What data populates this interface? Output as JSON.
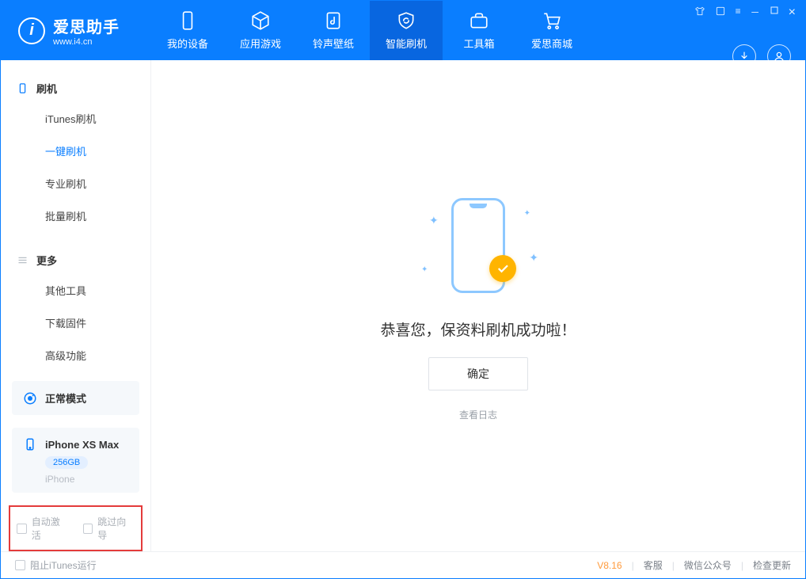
{
  "brand": {
    "name": "爱思助手",
    "url": "www.i4.cn",
    "logo_letter": "i"
  },
  "nav": {
    "items": [
      {
        "label": "我的设备"
      },
      {
        "label": "应用游戏"
      },
      {
        "label": "铃声壁纸"
      },
      {
        "label": "智能刷机"
      },
      {
        "label": "工具箱"
      },
      {
        "label": "爱思商城"
      }
    ]
  },
  "window_controls": {
    "shirt": "shirt-icon",
    "skin": "skin-icon",
    "menu": "menu-icon",
    "min": "minimize-icon",
    "max": "maximize-icon",
    "close": "close-icon"
  },
  "sidebar": {
    "sections": [
      {
        "title": "刷机",
        "items": [
          {
            "label": "iTunes刷机"
          },
          {
            "label": "一键刷机"
          },
          {
            "label": "专业刷机"
          },
          {
            "label": "批量刷机"
          }
        ]
      },
      {
        "title": "更多",
        "items": [
          {
            "label": "其他工具"
          },
          {
            "label": "下载固件"
          },
          {
            "label": "高级功能"
          }
        ]
      }
    ],
    "mode_label": "正常模式",
    "device": {
      "name": "iPhone XS Max",
      "storage": "256GB",
      "type": "iPhone"
    },
    "options": {
      "auto_activate": "自动激活",
      "skip_guide": "跳过向导"
    }
  },
  "main": {
    "success_message": "恭喜您，保资料刷机成功啦！",
    "ok_label": "确定",
    "view_log": "查看日志"
  },
  "footer": {
    "block_itunes": "阻止iTunes运行",
    "version": "V8.16",
    "links": {
      "support": "客服",
      "wechat": "微信公众号",
      "update": "检查更新"
    }
  },
  "colors": {
    "primary": "#0a7eff",
    "accent": "#ffb400",
    "highlight_border": "#e43b3b"
  }
}
